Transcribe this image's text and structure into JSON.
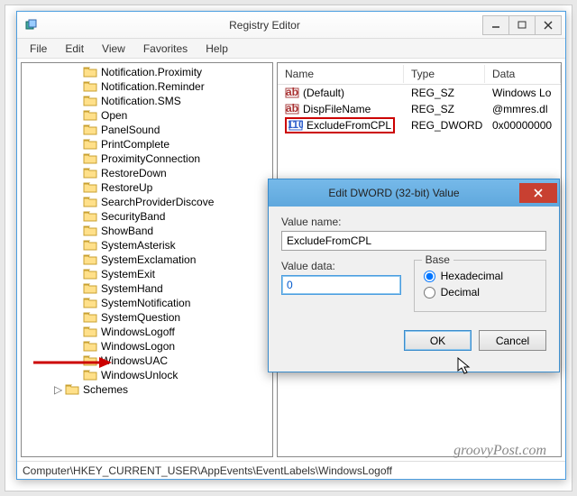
{
  "window": {
    "title": "Registry Editor"
  },
  "menu": {
    "file": "File",
    "edit": "Edit",
    "view": "View",
    "favorites": "Favorites",
    "help": "Help"
  },
  "tree": {
    "items": [
      "Notification.Proximity",
      "Notification.Reminder",
      "Notification.SMS",
      "Open",
      "PanelSound",
      "PrintComplete",
      "ProximityConnection",
      "RestoreDown",
      "RestoreUp",
      "SearchProviderDiscove",
      "SecurityBand",
      "ShowBand",
      "SystemAsterisk",
      "SystemExclamation",
      "SystemExit",
      "SystemHand",
      "SystemNotification",
      "SystemQuestion",
      "WindowsLogoff",
      "WindowsLogon",
      "WindowsUAC",
      "WindowsUnlock"
    ],
    "schemes": "Schemes",
    "highlighted_index": 18
  },
  "list": {
    "headers": {
      "name": "Name",
      "type": "Type",
      "data": "Data"
    },
    "rows": [
      {
        "icon": "string",
        "name": "(Default)",
        "type": "REG_SZ",
        "data": "Windows Lo"
      },
      {
        "icon": "string",
        "name": "DispFileName",
        "type": "REG_SZ",
        "data": "@mmres.dl"
      },
      {
        "icon": "dword",
        "name": "ExcludeFromCPL",
        "type": "REG_DWORD",
        "data": "0x00000000",
        "boxed": true
      }
    ]
  },
  "dialog": {
    "title": "Edit DWORD (32-bit) Value",
    "value_name_label": "Value name:",
    "value_name": "ExcludeFromCPL",
    "value_data_label": "Value data:",
    "value_data": "0",
    "base_label": "Base",
    "hex": "Hexadecimal",
    "dec": "Decimal",
    "base_selected": "hex",
    "ok": "OK",
    "cancel": "Cancel"
  },
  "statusbar": "Computer\\HKEY_CURRENT_USER\\AppEvents\\EventLabels\\WindowsLogoff",
  "watermark": "groovyPost.com"
}
